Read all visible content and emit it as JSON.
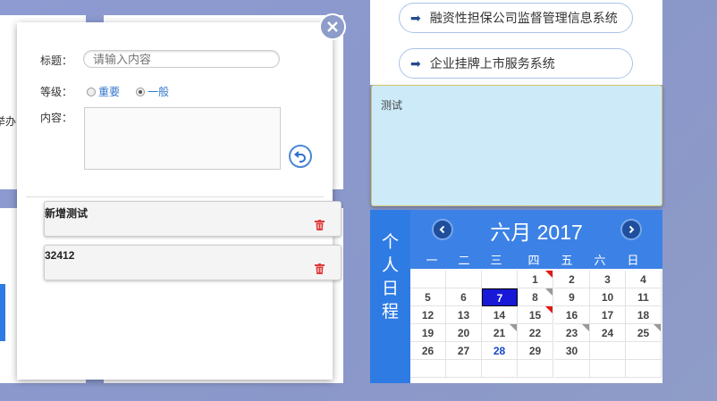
{
  "background_panels": {
    "left_partial_text": "举办",
    "left_strip": "blue-strip"
  },
  "modal": {
    "title_label": "标题：",
    "title_placeholder": "请输入内容",
    "level_label": "等级：",
    "level_options": [
      {
        "label": "重要",
        "selected": false
      },
      {
        "label": "一般",
        "selected": true
      }
    ],
    "content_label": "内容：",
    "notes": [
      {
        "title": "新增测试"
      },
      {
        "title": "32412"
      }
    ]
  },
  "systems": [
    {
      "label": "融资性担保公司监督管理信息系统"
    },
    {
      "label": "企业挂牌上市服务系统"
    }
  ],
  "note_box": {
    "text": "测试"
  },
  "calendar": {
    "side_label": [
      "个",
      "人",
      "日",
      "程"
    ],
    "month_title": "六月 2017",
    "weekdays": [
      "一",
      "二",
      "三",
      "四",
      "五",
      "六",
      "日"
    ],
    "days": [
      {
        "d": "1",
        "col": 3,
        "row": 0,
        "mark": "red"
      },
      {
        "d": "2",
        "col": 4,
        "row": 0
      },
      {
        "d": "3",
        "col": 5,
        "row": 0
      },
      {
        "d": "4",
        "col": 6,
        "row": 0
      },
      {
        "d": "5",
        "col": 0,
        "row": 1
      },
      {
        "d": "6",
        "col": 1,
        "row": 1
      },
      {
        "d": "7",
        "col": 2,
        "row": 1,
        "today": true
      },
      {
        "d": "8",
        "col": 3,
        "row": 1,
        "mark": "gray"
      },
      {
        "d": "9",
        "col": 4,
        "row": 1
      },
      {
        "d": "10",
        "col": 5,
        "row": 1
      },
      {
        "d": "11",
        "col": 6,
        "row": 1
      },
      {
        "d": "12",
        "col": 0,
        "row": 2
      },
      {
        "d": "13",
        "col": 1,
        "row": 2
      },
      {
        "d": "14",
        "col": 2,
        "row": 2
      },
      {
        "d": "15",
        "col": 3,
        "row": 2,
        "mark": "red"
      },
      {
        "d": "16",
        "col": 4,
        "row": 2
      },
      {
        "d": "17",
        "col": 5,
        "row": 2
      },
      {
        "d": "18",
        "col": 6,
        "row": 2
      },
      {
        "d": "19",
        "col": 0,
        "row": 3
      },
      {
        "d": "20",
        "col": 1,
        "row": 3
      },
      {
        "d": "21",
        "col": 2,
        "row": 3,
        "mark": "gray"
      },
      {
        "d": "22",
        "col": 3,
        "row": 3
      },
      {
        "d": "23",
        "col": 4,
        "row": 3,
        "mark": "gray"
      },
      {
        "d": "24",
        "col": 5,
        "row": 3
      },
      {
        "d": "25",
        "col": 6,
        "row": 3,
        "mark": "gray"
      },
      {
        "d": "26",
        "col": 0,
        "row": 4
      },
      {
        "d": "27",
        "col": 1,
        "row": 4
      },
      {
        "d": "28",
        "col": 2,
        "row": 4,
        "blue": true
      },
      {
        "d": "29",
        "col": 3,
        "row": 4
      },
      {
        "d": "30",
        "col": 4,
        "row": 4
      }
    ]
  },
  "colors": {
    "accent": "#3c82e6",
    "today": "#1818d8",
    "mark_red": "#e01818"
  }
}
